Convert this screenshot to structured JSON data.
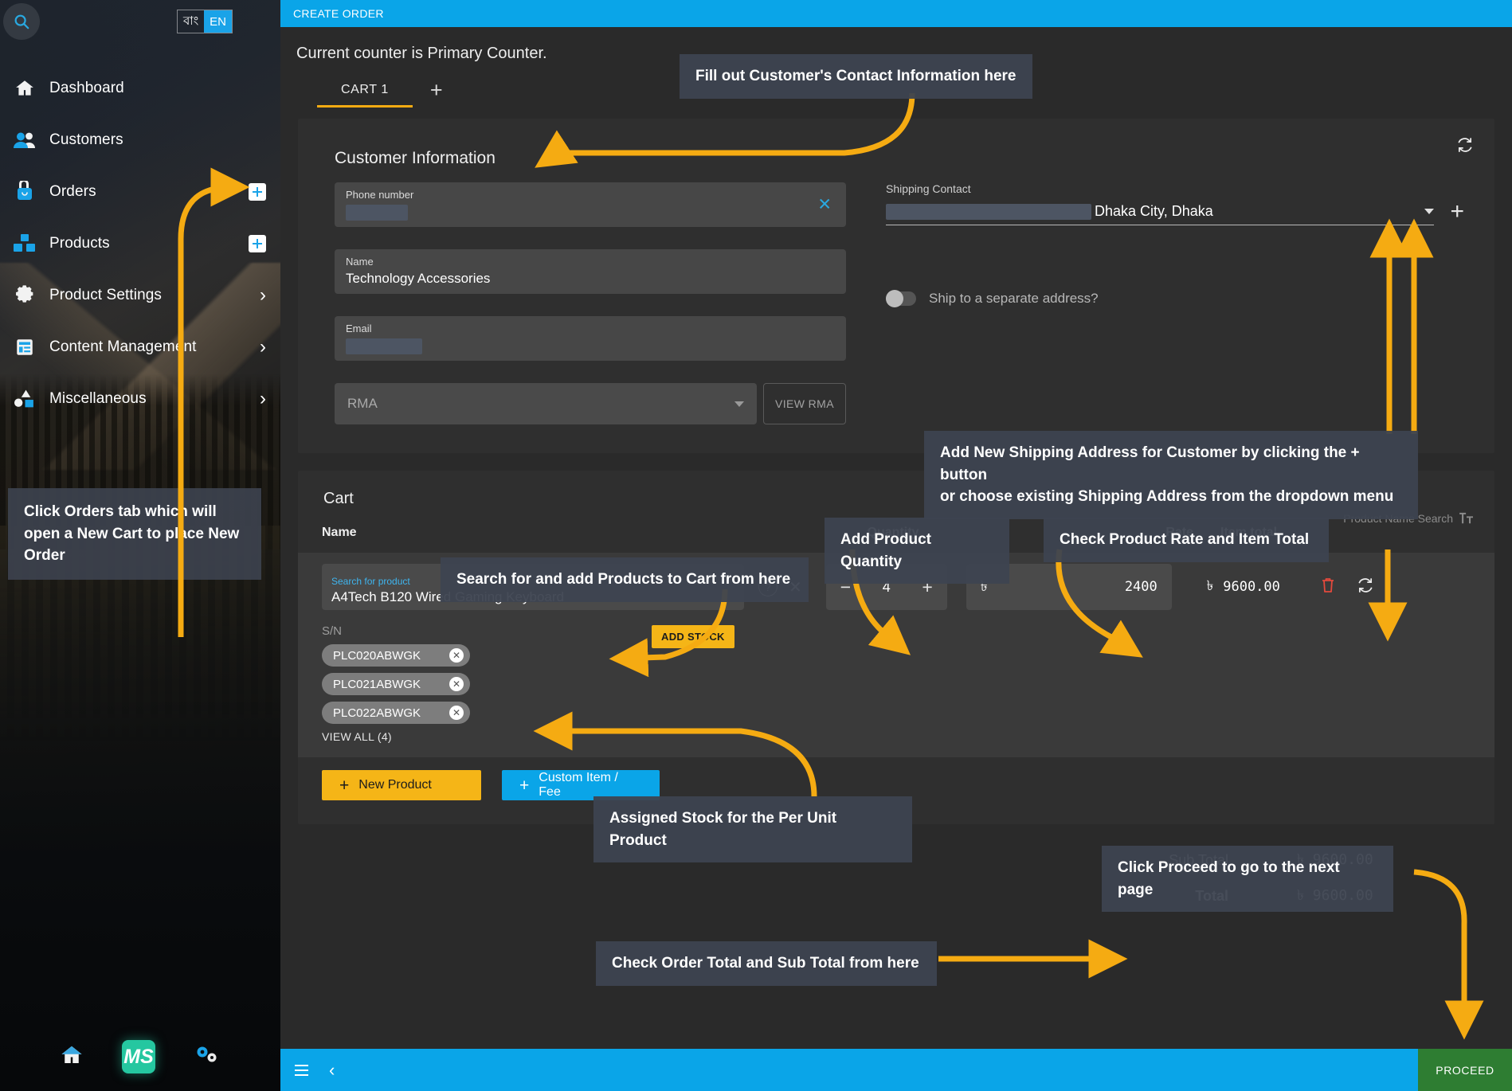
{
  "sidebar": {
    "lang": {
      "bn": "বাং",
      "en": "EN"
    },
    "items": [
      {
        "label": "Dashboard",
        "icon": "home-icon",
        "right": "none"
      },
      {
        "label": "Customers",
        "icon": "users-icon",
        "right": "none"
      },
      {
        "label": "Orders",
        "icon": "bag-lock-icon",
        "right": "plus"
      },
      {
        "label": "Products",
        "icon": "boxes-icon",
        "right": "plus"
      },
      {
        "label": "Product Settings",
        "icon": "gear-icon",
        "right": "chevron"
      },
      {
        "label": "Content Management",
        "icon": "document-list-icon",
        "right": "chevron"
      },
      {
        "label": "Miscellaneous",
        "icon": "shapes-icon",
        "right": "chevron"
      }
    ],
    "tooltip": "Click Orders tab which will open a New Cart to place New Order",
    "bottom": {
      "home": "home-icon",
      "logo": "MS",
      "settings": "gears-icon"
    }
  },
  "header": {
    "title": "CREATE ORDER",
    "counter_line": "Current counter is Primary Counter.",
    "tabs": [
      {
        "label": "CART 1",
        "active": true
      }
    ],
    "add_tab": "+"
  },
  "customer": {
    "section_title": "Customer Information",
    "phone": {
      "label": "Phone number",
      "value": "",
      "redacted": true
    },
    "name": {
      "label": "Name",
      "value": "Technology Accessories"
    },
    "email": {
      "label": "Email",
      "value": "",
      "redacted": true
    },
    "rma": {
      "placeholder": "RMA",
      "view_button": "VIEW RMA"
    },
    "shipping": {
      "label": "Shipping Contact",
      "value": "Dhaka City, Dhaka",
      "redacted": true,
      "add_label": "+"
    },
    "ship_separate": {
      "label": "Ship to a separate address?",
      "on": false
    },
    "sync_icon": "sync-icon"
  },
  "cart": {
    "title": "Cart",
    "product_name_search": "Product Name Search",
    "columns": {
      "name": "Name",
      "quantity": "Quantity",
      "rate": "Rate",
      "item_total": "Item total"
    },
    "rows": [
      {
        "search_label": "Search for product",
        "product": "A4Tech B120 Wired Gaming Keyboard",
        "quantity": "4",
        "rate_currency": "৳",
        "rate": "2400",
        "item_total_currency": "৳",
        "item_total": "9600.00",
        "sn_label": "S/N",
        "add_stock": "ADD STOCK",
        "serials": [
          "PLC020ABWGK",
          "PLC021ABWGK",
          "PLC022ABWGK"
        ],
        "view_all": "VIEW ALL (4)"
      }
    ],
    "buttons": {
      "new_product": "New Product",
      "custom_item": "Custom Item / Fee"
    }
  },
  "totals": {
    "sub_total_label": "Sub Total",
    "sub_total_value": "৳ 9600.00",
    "total_label": "Total",
    "total_value": "৳ 9600.00"
  },
  "bottombar": {
    "proceed": "PROCEED"
  },
  "annotations": {
    "fill_contact": "Fill out Customer's Contact Information here",
    "add_shipping": "Add New Shipping Address for Customer by clicking the + button\nor choose existing Shipping Address from the dropdown menu",
    "add_shipping_l1": "Add New Shipping Address for Customer by clicking the + button",
    "add_shipping_l2": "or choose existing Shipping Address from the dropdown menu",
    "search_products": "Search for and add Products to Cart from here",
    "add_qty": "Add Product Quantity",
    "check_rate": "Check Product Rate and Item Total",
    "assigned_stock": "Assigned Stock for the Per Unit Product",
    "check_totals": "Check Order Total and Sub Total from here",
    "click_proceed": "Click Proceed to go to the next page"
  },
  "colors": {
    "accent_blue": "#0aa5e8",
    "accent_yellow": "#f5b517",
    "proceed_green": "#2e7d32",
    "panel": "#2f2f2f",
    "field": "#4a4a4a"
  }
}
